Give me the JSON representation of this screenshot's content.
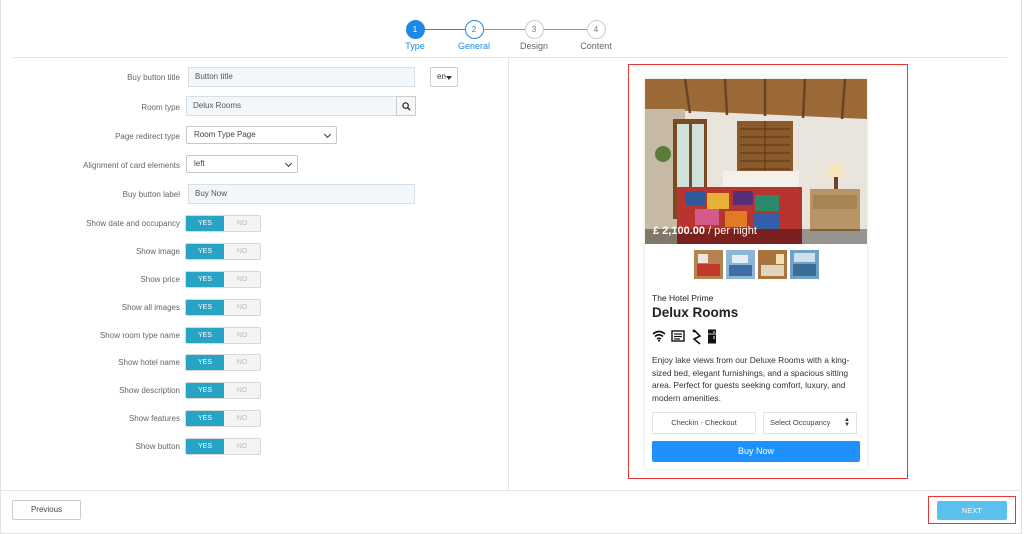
{
  "stepper": {
    "steps": [
      {
        "num": "1",
        "label": "Type"
      },
      {
        "num": "2",
        "label": "General"
      },
      {
        "num": "3",
        "label": "Design"
      },
      {
        "num": "4",
        "label": "Content"
      }
    ]
  },
  "form": {
    "buy_button_title": {
      "label": "Buy button title",
      "value": "Button title"
    },
    "language": "en",
    "room_type": {
      "label": "Room type",
      "value": "Delux Rooms"
    },
    "page_redirect_type": {
      "label": "Page redirect type",
      "value": "Room Type Page"
    },
    "alignment": {
      "label": "Alignment of card elements",
      "value": "left"
    },
    "buy_button_label": {
      "label": "Buy button label",
      "value": "Buy Now"
    },
    "toggles": [
      {
        "label": "Show date and occupancy",
        "yes": "YES",
        "no": "NO"
      },
      {
        "label": "Show image",
        "yes": "YES",
        "no": "NO"
      },
      {
        "label": "Show price",
        "yes": "YES",
        "no": "NO"
      },
      {
        "label": "Show all images",
        "yes": "YES",
        "no": "NO"
      },
      {
        "label": "Show room type name",
        "yes": "YES",
        "no": "NO"
      },
      {
        "label": "Show hotel name",
        "yes": "YES",
        "no": "NO"
      },
      {
        "label": "Show description",
        "yes": "YES",
        "no": "NO"
      },
      {
        "label": "Show features",
        "yes": "YES",
        "no": "NO"
      },
      {
        "label": "Show button",
        "yes": "YES",
        "no": "NO"
      }
    ]
  },
  "preview": {
    "price": "£ 2,100.00",
    "price_suffix": " / per night",
    "hotel_name": "The Hotel Prime",
    "room_name": "Delux Rooms",
    "features": [
      "wifi-icon",
      "newspaper-icon",
      "hairdryer-icon",
      "fridge-icon"
    ],
    "description": "Enjoy lake views from our Deluxe Rooms with a king-sized bed, elegant furnishings, and a spacious sitting area. Perfect for guests seeking comfort, luxury, and modern amenities.",
    "checkin_label": "Checkin - Checkout",
    "occupancy_label": "Select Occupancy",
    "buy_label": "Buy Now"
  },
  "footer": {
    "previous_label": "Previous",
    "next_label": "NEXT"
  },
  "colors": {
    "primary": "#1e88e5",
    "toggle_yes": "#27a3c6",
    "buy_button": "#1e90ff",
    "highlight": "#e53935",
    "next_button": "#5bc0eb"
  }
}
